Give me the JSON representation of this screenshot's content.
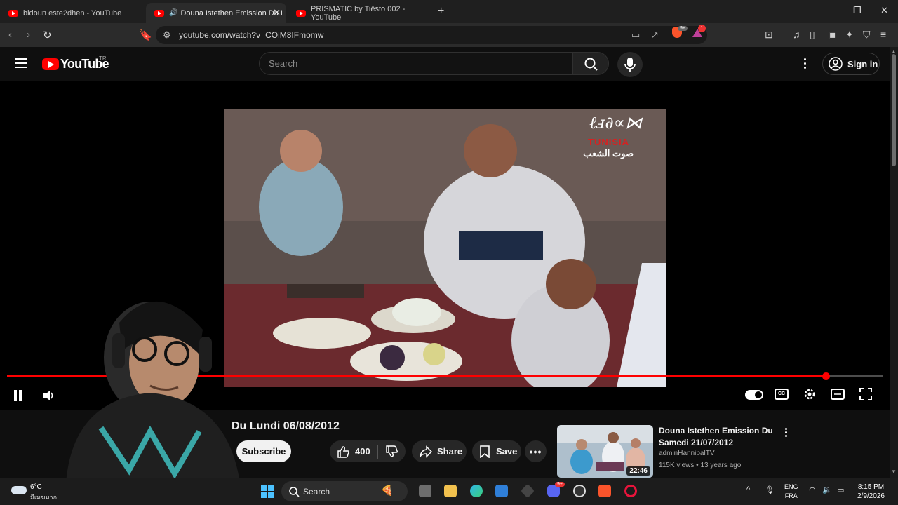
{
  "browser": {
    "tabs": [
      {
        "title": "bidoun este2dhen - YouTube",
        "active": false
      },
      {
        "title": "Douna Istethen Emission Du I",
        "active": true
      },
      {
        "title": "PRISMATIC by Tiësto 002 - YouTube",
        "active": false
      }
    ],
    "url": "youtube.com/watch?v=COiM8IFmomw",
    "badge_count": "9+",
    "notif_count": "1"
  },
  "youtube": {
    "logo_text": "YouTube",
    "region": "TR",
    "search_placeholder": "Search",
    "signin_label": "Sign in"
  },
  "player": {
    "watermark_text": "TUNISIA",
    "watermark_arabic": "صوت الشعب",
    "progress_fraction": 0.935,
    "cc_label": "CC"
  },
  "video": {
    "title": "Du Lundi 06/08/2012",
    "subscribe_label": "Subscribe",
    "like_count": "400",
    "share_label": "Share",
    "save_label": "Save"
  },
  "recommended": {
    "title": "Douna Istethen Emission Du Samedi 21/07/2012",
    "channel": "adminHannibalTV",
    "meta": "115K views • 13 years ago",
    "duration": "22:46"
  },
  "taskbar": {
    "temp": "6°C",
    "weather_desc": "มีเมฆมาก",
    "search_label": "Search",
    "lang_line1": "ENG",
    "lang_line2": "FRA",
    "time": "8:15 PM",
    "date": "2/9/2026",
    "discord_badge": "9+"
  },
  "colors": {
    "accent_red": "#ff0000",
    "background": "#0f0f0f"
  }
}
